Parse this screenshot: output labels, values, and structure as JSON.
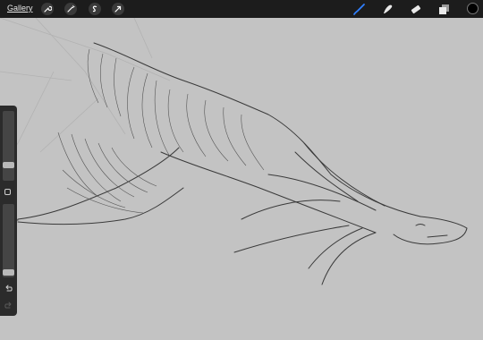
{
  "topbar": {
    "gallery_label": "Gallery",
    "left_tools": [
      "wrench-icon",
      "magic-wand-icon",
      "selection-icon",
      "transform-icon"
    ],
    "right_tools": [
      "brush-icon",
      "smudge-icon",
      "eraser-icon",
      "layers-icon"
    ],
    "active_tool": "brush-icon",
    "current_color": "#000000"
  },
  "sidebar": {
    "brush_size": 0.2,
    "opacity": 0.03
  },
  "colors": {
    "canvas": "#c3c3c3",
    "ui_bar": "#1c1c1c",
    "active_tool": "#2f7fff"
  }
}
